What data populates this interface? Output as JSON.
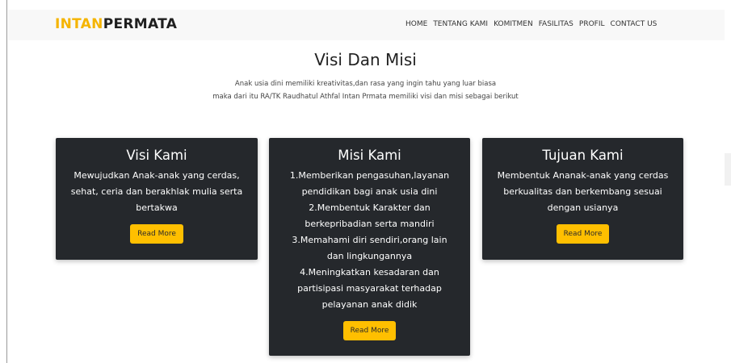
{
  "brand": {
    "part1": "INTAN",
    "part2": "PERMATA"
  },
  "nav": [
    {
      "label": "HOME"
    },
    {
      "label": "TENTANG KAMI"
    },
    {
      "label": "KOMITMEN"
    },
    {
      "label": "FASILITAS"
    },
    {
      "label": "PROFIL"
    },
    {
      "label": "CONTACT US"
    }
  ],
  "section": {
    "title": "Visi Dan Misi",
    "intro": [
      "Anak usia dini memiliki kreativitas,dan rasa yang ingin tahu yang luar biasa",
      "maka dari itu RA/TK Raudhatul Athfal Intan Prmata memiliki visi dan misi sebagai berikut"
    ]
  },
  "cards": [
    {
      "title": "Visi Kami",
      "lines": [
        "Mewujudkan Anak-anak yang cerdas,",
        "sehat, ceria dan berakhlak mulia serta",
        "bertakwa"
      ],
      "button": "Read More"
    },
    {
      "title": "Misi Kami",
      "lines": [
        "1.Memberikan pengasuhan,layanan",
        "pendidikan bagi anak usia dini",
        "2.Membentuk Karakter dan",
        "berkepribadian serta mandiri",
        "3.Memahami diri sendiri,orang lain",
        "dan lingkungannya",
        "4.Meningkatkan kesadaran dan",
        "partisipasi masyarakat terhadap",
        "pelayanan anak didik"
      ],
      "button": "Read More"
    },
    {
      "title": "Tujuan Kami",
      "lines": [
        "Membentuk Ananak-anak yang cerdas",
        "berkualitas dan berkembang sesuai",
        "dengan usianya"
      ],
      "button": "Read More"
    }
  ],
  "colors": {
    "accent": "#ffbf00",
    "card_bg": "#25282c",
    "navbar_bg": "#f8f8f8"
  }
}
